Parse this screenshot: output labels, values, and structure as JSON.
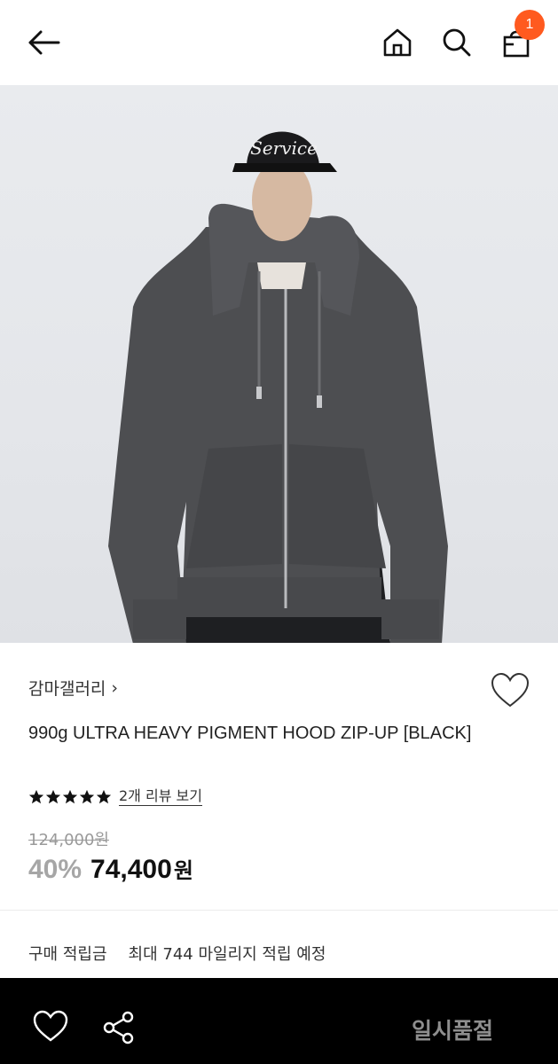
{
  "header": {
    "back_icon": "arrow-left-icon",
    "home_icon": "home-icon",
    "search_icon": "search-icon",
    "cart_icon": "shopping-bag-icon",
    "cart_count": "1",
    "badge_color": "#ff5a1f"
  },
  "product": {
    "brand": "감마갤러리",
    "brand_chevron": "›",
    "title": "990g ULTRA HEAVY PIGMENT HOOD ZIP-UP [BLACK]",
    "rating_stars": 5,
    "review_link": "2개 리뷰 보기",
    "original_price": "124,000원",
    "discount": "40%",
    "sale_price": "74,400",
    "currency": "원",
    "cap_text": "Service"
  },
  "points": {
    "label": "구매 적립금",
    "value": "최대 744 마일리지 적립 예정"
  },
  "bottom_bar": {
    "wish_icon": "heart-icon",
    "share_icon": "share-icon",
    "status": "일시품절",
    "background": "#000000"
  }
}
